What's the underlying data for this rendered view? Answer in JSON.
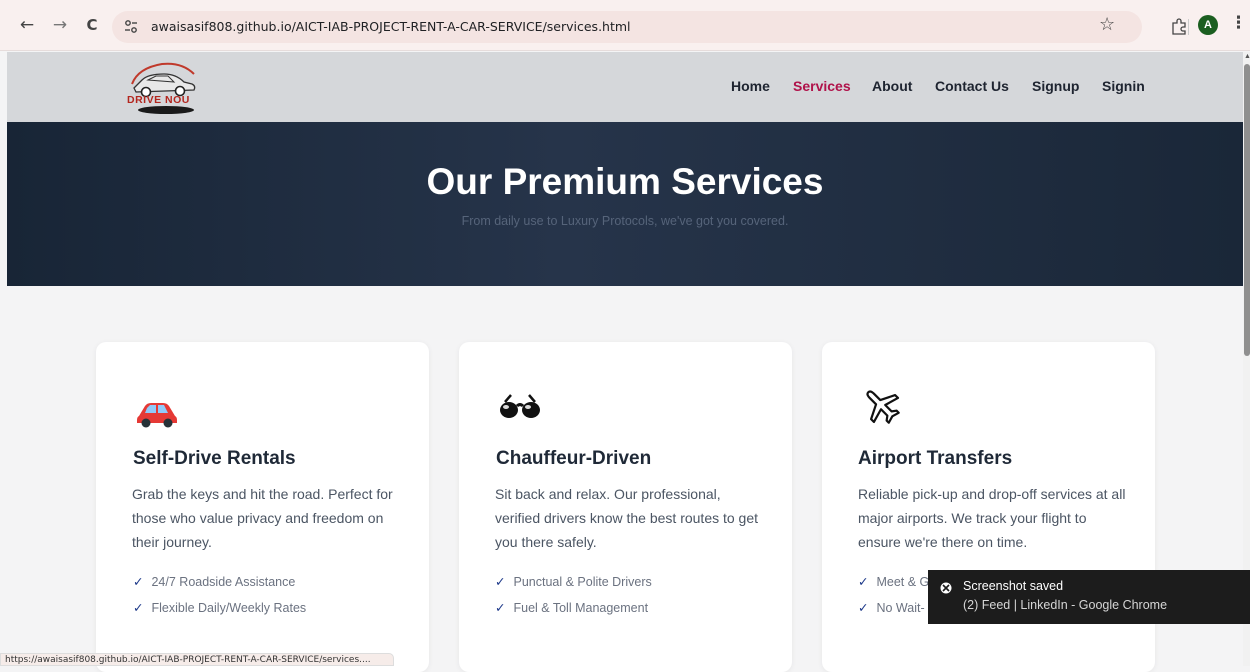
{
  "browser": {
    "back_icon": "←",
    "forward_icon": "→",
    "reload_icon": "C",
    "url": "awaisasif808.github.io/AICT-IAB-PROJECT-RENT-A-CAR-SERVICE/services.html",
    "star_icon": "☆",
    "profile_initial": "A",
    "menu_icon": "⋮",
    "status_url": "https://awaisasif808.github.io/AICT-IAB-PROJECT-RENT-A-CAR-SERVICE/services...."
  },
  "site": {
    "logo_text": "DRIVE NOU",
    "nav": {
      "home": "Home",
      "services": "Services",
      "about": "About",
      "contact": "Contact Us",
      "signup": "Signup",
      "signin": "Signin"
    },
    "active_color": "#b0124a"
  },
  "hero": {
    "title": "Our Premium Services",
    "subtitle": "From daily use to Luxury Protocols, we've got you covered."
  },
  "cards": [
    {
      "icon": "car-icon",
      "title": "Self-Drive Rentals",
      "description": "Grab the keys and hit the road. Perfect for those who value privacy and freedom on their journey.",
      "features": [
        "24/7 Roadside Assistance",
        "Flexible Daily/Weekly Rates"
      ]
    },
    {
      "icon": "sunglasses-icon",
      "title": "Chauffeur-Driven",
      "description": "Sit back and relax. Our professional, verified drivers know the best routes to get you there safely.",
      "features": [
        "Punctual & Polite Drivers",
        "Fuel & Toll Management"
      ]
    },
    {
      "icon": "airplane-icon",
      "title": "Airport Transfers",
      "description": "Reliable pick-up and drop-off services at all major airports. We track your flight to ensure we're there on time.",
      "features": [
        "Meet & G",
        "No Wait-"
      ]
    }
  ],
  "check_mark": "✓",
  "toast": {
    "title": "Screenshot saved",
    "subtitle": "(2) Feed | LinkedIn - Google Chrome"
  }
}
